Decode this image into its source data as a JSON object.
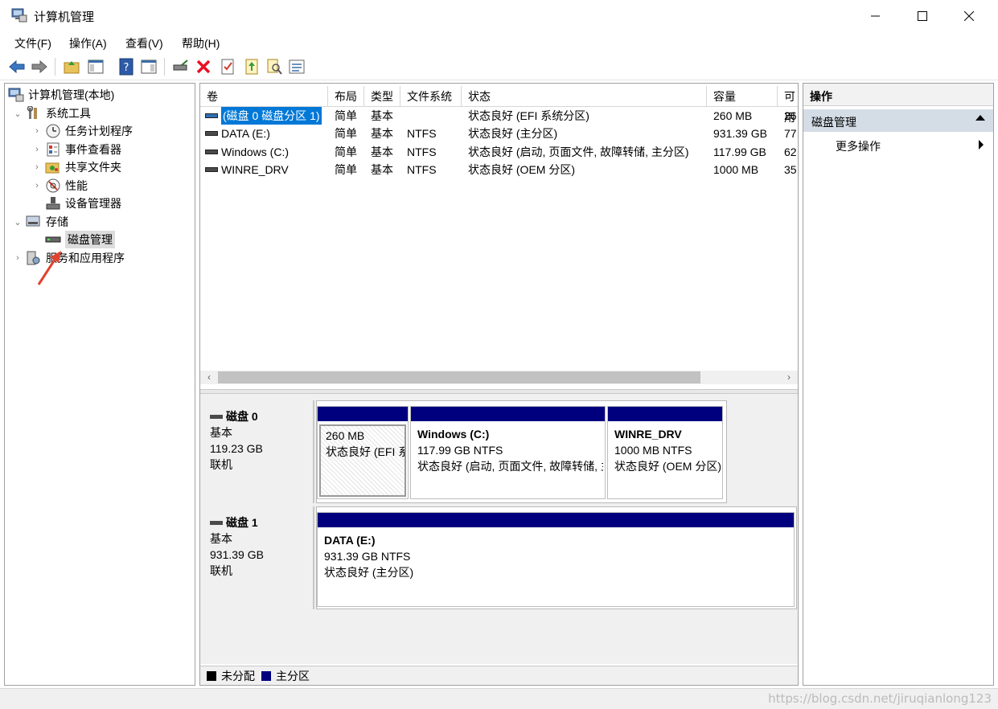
{
  "window": {
    "title": "计算机管理"
  },
  "menu": [
    "文件(F)",
    "操作(A)",
    "查看(V)",
    "帮助(H)"
  ],
  "toolbar": {
    "icons": [
      "back-icon",
      "forward-icon",
      "up-folder-icon",
      "show-hide-tree-icon",
      "help-icon",
      "show-hide-action-pane-icon",
      "connect-drive-icon",
      "delete-icon",
      "properties-icon",
      "open-icon",
      "search-icon",
      "list-view-icon"
    ],
    "delete_color": "#e81123"
  },
  "tree": {
    "root": "计算机管理(本地)",
    "system_tools": "系统工具",
    "task_scheduler": "任务计划程序",
    "event_viewer": "事件查看器",
    "shared_folders": "共享文件夹",
    "performance": "性能",
    "device_manager": "设备管理器",
    "storage": "存储",
    "disk_management": "磁盘管理",
    "services_apps": "服务和应用程序"
  },
  "volumes": {
    "columns": [
      "卷",
      "布局",
      "类型",
      "文件系统",
      "状态",
      "容量",
      "可用"
    ],
    "rows": [
      {
        "volume": "(磁盘 0 磁盘分区 1)",
        "layout": "简单",
        "type": "基本",
        "fs": "",
        "status": "状态良好 (EFI 系统分区)",
        "capacity": "260 MB",
        "free": "26"
      },
      {
        "volume": "DATA (E:)",
        "layout": "简单",
        "type": "基本",
        "fs": "NTFS",
        "status": "状态良好 (主分区)",
        "capacity": "931.39 GB",
        "free": "77"
      },
      {
        "volume": "Windows (C:)",
        "layout": "简单",
        "type": "基本",
        "fs": "NTFS",
        "status": "状态良好 (启动, 页面文件, 故障转储, 主分区)",
        "capacity": "117.99 GB",
        "free": "62"
      },
      {
        "volume": "WINRE_DRV",
        "layout": "简单",
        "type": "基本",
        "fs": "NTFS",
        "status": "状态良好 (OEM 分区)",
        "capacity": "1000 MB",
        "free": "35"
      }
    ]
  },
  "scroll": {
    "left": "‹",
    "right": "›"
  },
  "disks": [
    {
      "name": "磁盘 0",
      "type": "基本",
      "size": "119.23 GB",
      "state": "联机",
      "partitions": [
        {
          "name": "",
          "size": "260 MB",
          "status": "状态良好 (EFI 系统分区)"
        },
        {
          "name": "Windows  (C:)",
          "size": "117.99 GB NTFS",
          "status": "状态良好 (启动, 页面文件, 故障转储, 主分区)"
        },
        {
          "name": "WINRE_DRV",
          "size": "1000 MB NTFS",
          "status": "状态良好 (OEM 分区)"
        }
      ]
    },
    {
      "name": "磁盘 1",
      "type": "基本",
      "size": "931.39 GB",
      "state": "联机",
      "partitions": [
        {
          "name": "DATA  (E:)",
          "size": "931.39 GB NTFS",
          "status": "状态良好 (主分区)"
        }
      ]
    }
  ],
  "legend": {
    "unallocated": "未分配",
    "unallocated_color": "#000000",
    "primary": "主分区",
    "primary_color": "#00007f"
  },
  "actions": {
    "header": "操作",
    "section": "磁盘管理",
    "more": "更多操作"
  },
  "watermark": "https://blog.csdn.net/jiruqianlong123",
  "annotation_color": "#e0432f"
}
